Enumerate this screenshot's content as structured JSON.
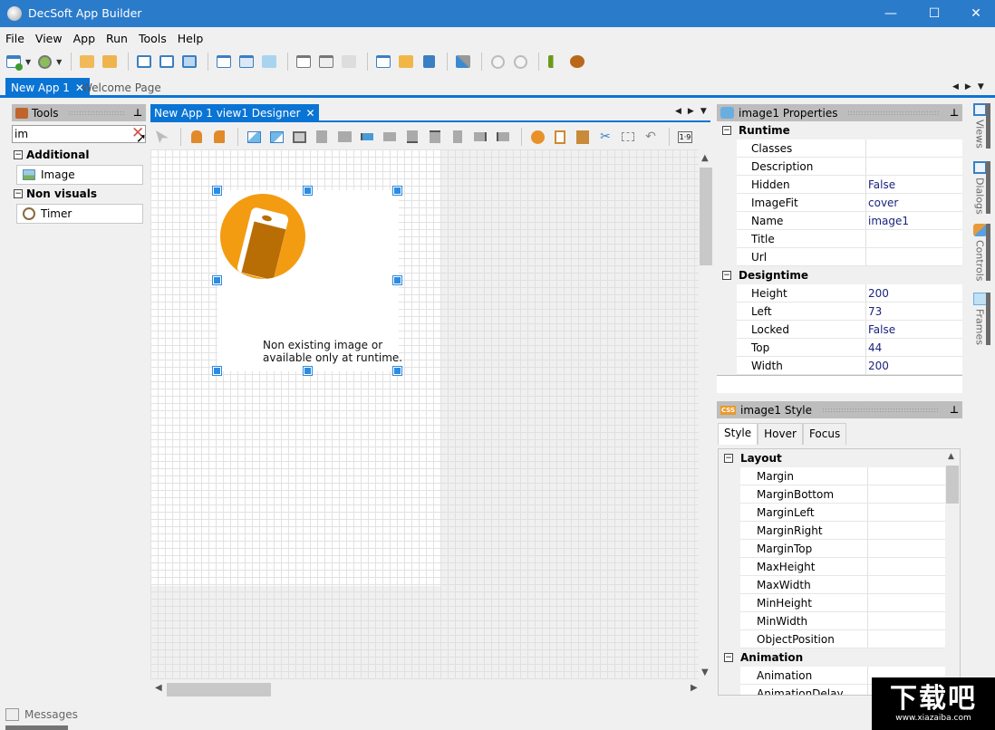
{
  "window": {
    "title": "DecSoft App Builder",
    "controls": {
      "minimize": "—",
      "maximize": "☐",
      "close": "✕"
    }
  },
  "menu": [
    "File",
    "View",
    "App",
    "Run",
    "Tools",
    "Help"
  ],
  "toolbar": {
    "buttons": [
      "new-app",
      "open-recent",
      "find-in-files",
      "open-folder",
      "save",
      "save-as",
      "save-all",
      "new-view",
      "new-dialog",
      "new-frame",
      "remove-view",
      "remove-dialog",
      "remove-frame",
      "edit-view",
      "app-package",
      "app-notes",
      "app-tools",
      "run",
      "stop",
      "build",
      "debug"
    ]
  },
  "doc_tabs": {
    "active": "New App 1",
    "inactive": "Welcome Page",
    "close_glyph": "✕"
  },
  "tools_panel": {
    "title": "Tools",
    "search_value": "im",
    "groups": [
      {
        "label": "Additional",
        "items": [
          "Image"
        ]
      },
      {
        "label": "Non visuals",
        "items": [
          "Timer"
        ]
      }
    ]
  },
  "designer": {
    "tab_label": "New App 1 view1 Designer",
    "toolbar_buttons": [
      "pointer",
      "lock",
      "unlock",
      "bring-to-front",
      "send-to-back",
      "same-size",
      "same-height",
      "same-width",
      "align-left",
      "center-horizontal",
      "align-bottom",
      "align-top",
      "center-vertical",
      "align-right",
      "align-left-edges",
      "delete",
      "copy",
      "paste",
      "cut",
      "select-all",
      "undo",
      "tab-order"
    ],
    "image_placeholder_text_line1": "Non existing image or",
    "image_placeholder_text_line2": "available only at runtime."
  },
  "properties_panel": {
    "title": "image1 Properties",
    "categories": [
      {
        "label": "Runtime",
        "rows": [
          {
            "key": "Classes",
            "value": ""
          },
          {
            "key": "Description",
            "value": ""
          },
          {
            "key": "Hidden",
            "value": "False"
          },
          {
            "key": "ImageFit",
            "value": "cover"
          },
          {
            "key": "Name",
            "value": "image1"
          },
          {
            "key": "Title",
            "value": ""
          },
          {
            "key": "Url",
            "value": ""
          }
        ]
      },
      {
        "label": "Designtime",
        "rows": [
          {
            "key": "Height",
            "value": "200"
          },
          {
            "key": "Left",
            "value": "73"
          },
          {
            "key": "Locked",
            "value": "False"
          },
          {
            "key": "Top",
            "value": "44"
          },
          {
            "key": "Width",
            "value": "200"
          }
        ]
      }
    ]
  },
  "side_tabs": [
    "Views",
    "Dialogs",
    "Controls",
    "Frames"
  ],
  "style_panel": {
    "title": "image1 Style",
    "badge": "CSS",
    "tabs": [
      "Style",
      "Hover",
      "Focus"
    ],
    "active_tab": "Style",
    "categories": [
      {
        "label": "Layout",
        "rows": [
          "Margin",
          "MarginBottom",
          "MarginLeft",
          "MarginRight",
          "MarginTop",
          "MaxHeight",
          "MaxWidth",
          "MinHeight",
          "MinWidth",
          "ObjectPosition"
        ]
      },
      {
        "label": "Animation",
        "rows": [
          "Animation",
          "AnimationDelay"
        ]
      }
    ]
  },
  "bottom": {
    "messages_label": "Messages"
  },
  "watermark": {
    "big": "下载吧",
    "small": "www.xiazaiba.com"
  }
}
